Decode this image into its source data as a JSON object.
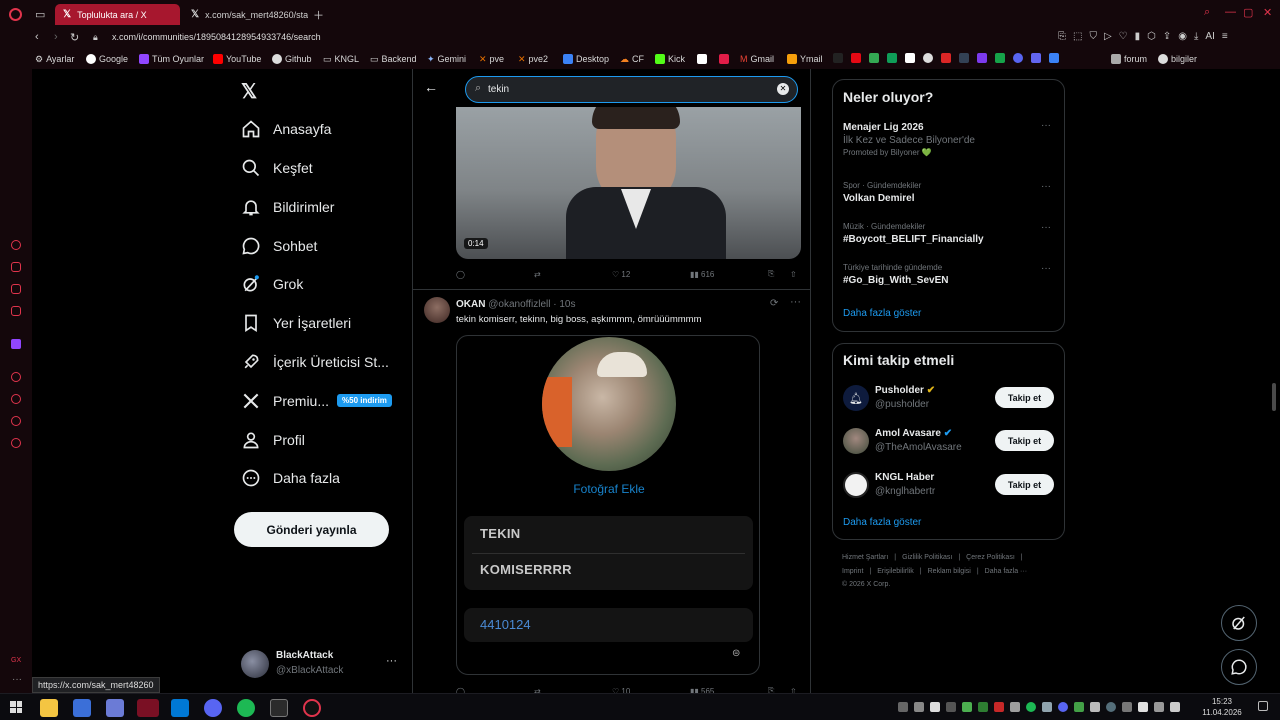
{
  "browser": {
    "tabs": [
      {
        "title": "Toplulukta ara / X",
        "active": true
      },
      {
        "title": "x.com/sak_mert48260/sta",
        "active": false
      }
    ],
    "url": "x.com/i/communities/1895084128954933746/search",
    "ai_label": "AI",
    "bookmarks": [
      "Ayarlar",
      "Google",
      "Tüm Oyunlar",
      "YouTube",
      "Github",
      "KNGL",
      "Backend",
      "Gemini",
      "pve",
      "pve2",
      "Desktop",
      "CF",
      "Kick",
      "Gmail",
      "Ymail",
      "forum",
      "bilgiler"
    ],
    "status_url": "https://x.com/sak_mert48260"
  },
  "nav": {
    "items": [
      "Anasayfa",
      "Keşfet",
      "Bildirimler",
      "Sohbet",
      "Grok",
      "Yer İşaretleri",
      "İçerik Üreticisi St...",
      "Premiu...",
      "Profil",
      "Daha fazla"
    ],
    "premium_badge": "%50 indirim",
    "post_button": "Gönderi yayınla",
    "account": {
      "name": "BlackAttack",
      "handle": "@xBlackAttack",
      "more": "···"
    }
  },
  "search": {
    "query": "tekin"
  },
  "tweet1": {
    "video_duration": "0:14",
    "likes": "12",
    "views": "616"
  },
  "tweet2": {
    "name": "OKAN",
    "handle": "@okanoffizlell",
    "time": "· 10s",
    "text": "tekin komiserr, tekinn, big boss, aşkımmm, ömrüüümmmm",
    "photo_label": "Fotoğraf Ekle",
    "field1": "TEKIN",
    "field2": "KOMISERRRR",
    "field3": "4410124",
    "likes": "10",
    "views": "565"
  },
  "trends": {
    "title": "Neler oluyor?",
    "items": [
      {
        "category": "",
        "name": "Menajer Lig 2026",
        "sub": "İlk Kez ve Sadece Bilyoner'de",
        "promo": "Promoted by Bilyoner 💚"
      },
      {
        "category": "Spor · Gündemdekiler",
        "name": "Volkan Demirel"
      },
      {
        "category": "Müzik · Gündemdekiler",
        "name": "#Boycott_BELIFT_Financially"
      },
      {
        "category": "Türkiye tarihinde gündemde",
        "name": "#Go_Big_With_SevEN"
      }
    ],
    "show_more": "Daha fazla göster"
  },
  "follow": {
    "title": "Kimi takip etmeli",
    "items": [
      {
        "name": "Pusholder",
        "handle": "@pusholder",
        "verified": "gold"
      },
      {
        "name": "Amol Avasare",
        "handle": "@TheAmolAvasare",
        "verified": "blue"
      },
      {
        "name": "KNGL Haber",
        "handle": "@knglhabertr",
        "verified": ""
      }
    ],
    "button": "Takip et",
    "show_more": "Daha fazla göster"
  },
  "footer": {
    "links": [
      "Hizmet Şartları",
      "Gizlilik Politikası",
      "Çerez Politikası",
      "Imprint",
      "Erişilebilirlik",
      "Reklam bilgisi",
      "Daha fazla ···"
    ],
    "copyright": "© 2026 X Corp."
  },
  "taskbar": {
    "time": "15:23",
    "date": "11.04.2026"
  },
  "colors": {
    "accent": "#1d9bf0",
    "opera_red": "#a7172e",
    "bg": "#000000"
  }
}
